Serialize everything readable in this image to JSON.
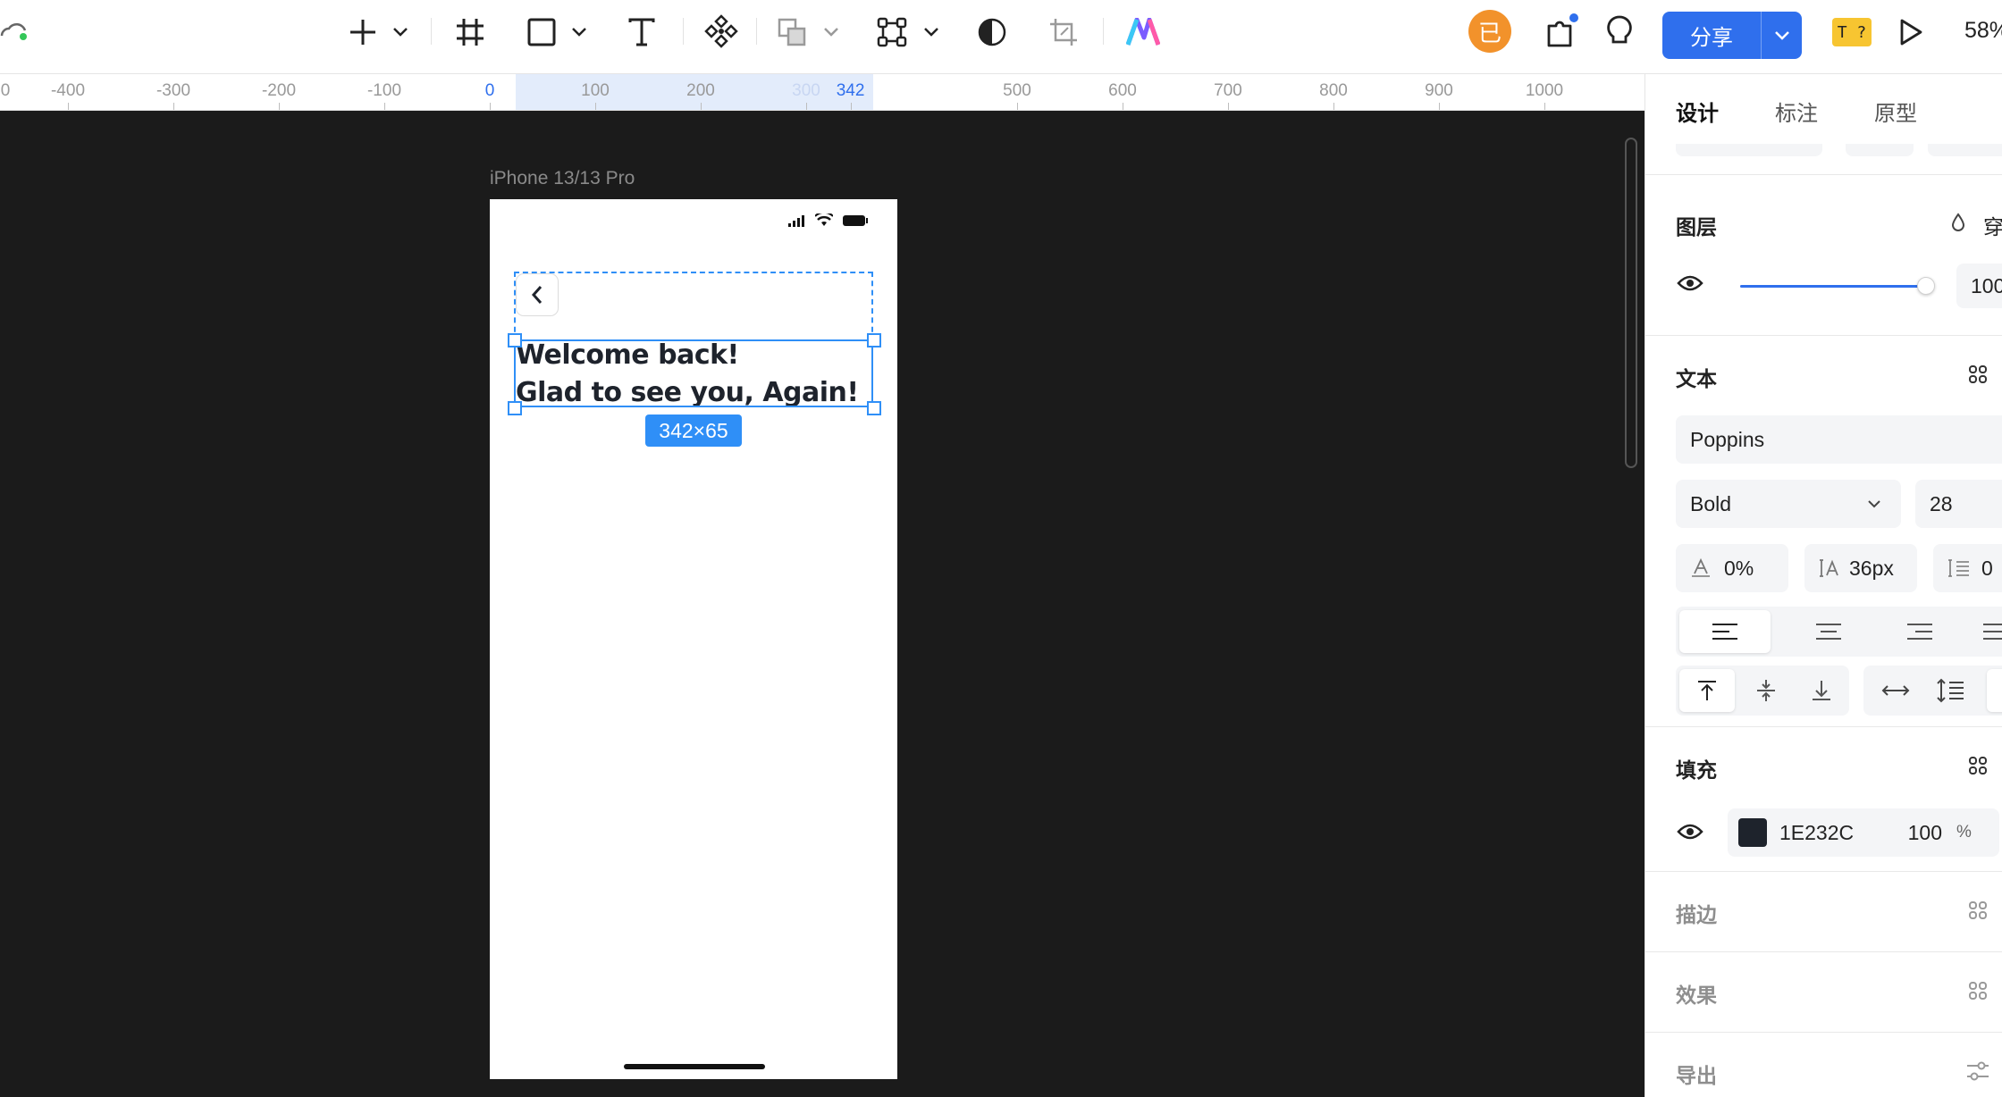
{
  "toolbar": {
    "share_label": "分享",
    "zoom_label": "58%",
    "avatar_initial": "已",
    "plugin_badge": "T ?",
    "tools": [
      "cloud-sync-icon",
      "plus-icon",
      "chevron-down-icon",
      "frame-tool-icon",
      "rectangle-tool-icon",
      "chevron-down-icon",
      "text-tool-icon",
      "component-tool-icon",
      "boolean-tool-icon",
      "chevron-down-icon",
      "vector-tool-icon",
      "chevron-down-icon",
      "mask-icon",
      "crop-icon",
      "ai-logo-icon"
    ],
    "colors": {
      "primary": "#2f6fed",
      "avatar": "#f2922b",
      "badge": "#f7c531"
    }
  },
  "ruler": {
    "ticks": [
      {
        "value": 0,
        "label": "0"
      },
      {
        "value": -400,
        "label": "-400"
      },
      {
        "value": -300,
        "label": "-300"
      },
      {
        "value": -200,
        "label": "-200"
      },
      {
        "value": -100,
        "label": "-100"
      },
      {
        "value": 0,
        "label": "0",
        "highlight": true
      },
      {
        "value": 100,
        "label": "100"
      },
      {
        "value": 200,
        "label": "200"
      },
      {
        "value": 300,
        "label": "300",
        "faded": true
      },
      {
        "value": 342,
        "label": "342",
        "highlight": true
      },
      {
        "value": 500,
        "label": "500"
      },
      {
        "value": 600,
        "label": "600"
      },
      {
        "value": 700,
        "label": "700"
      },
      {
        "value": 800,
        "label": "800"
      },
      {
        "value": 900,
        "label": "900"
      },
      {
        "value": 1000,
        "label": "1000"
      }
    ]
  },
  "canvas": {
    "frame_label": "iPhone 13/13 Pro",
    "heading_line1": "Welcome back!",
    "heading_line2": "Glad to see you, Again!",
    "size_badge": "342×65",
    "text_color": "#1E232C",
    "selection_color": "#2f8ff7"
  },
  "panel": {
    "tabs": [
      {
        "label": "设计",
        "active": true
      },
      {
        "label": "标注",
        "active": false
      },
      {
        "label": "原型",
        "active": false
      }
    ],
    "layer": {
      "title": "图层",
      "blend_label": "穿",
      "opacity_value": "100",
      "opacity_fraction": 0.99
    },
    "text": {
      "title": "文本",
      "font_family": "Poppins",
      "font_weight": "Bold",
      "font_size": "28",
      "letter_spacing": "0%",
      "line_height": "36px",
      "paragraph_spacing": "0"
    },
    "fill": {
      "title": "填充",
      "hex": "1E232C",
      "opacity": "100",
      "unit": "%",
      "swatch": "#1E232C"
    },
    "stroke": {
      "title": "描边"
    },
    "effects": {
      "title": "效果"
    },
    "export": {
      "title": "导出"
    }
  }
}
